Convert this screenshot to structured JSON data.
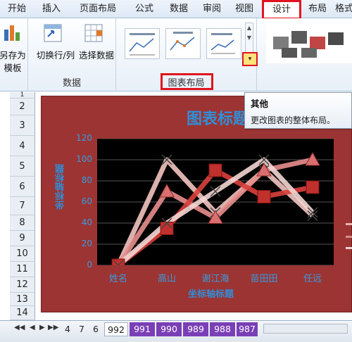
{
  "ribbon_tabs": [
    "开始",
    "插入",
    "页面布局",
    "公式",
    "数据",
    "审阅",
    "视图",
    "设计",
    "布局",
    "格式"
  ],
  "ribbon": {
    "save_template_line1": "另存为",
    "save_template_line2": "模板",
    "switch_rowcol": "切换行/列",
    "select_data": "选择数据",
    "group_data": "数据",
    "group_chart_layout": "图表布局"
  },
  "tooltip": {
    "title": "其他",
    "desc": "更改图表的整体布局。"
  },
  "rows": [
    "1",
    "2",
    "3",
    "4",
    "5",
    "6",
    "7",
    "8",
    "9",
    "10",
    "11",
    "12",
    "13",
    "14"
  ],
  "chart_data": {
    "type": "line",
    "title": "图表标题",
    "xlabel": "坐标轴标题",
    "ylabel": "坐标轴标题",
    "categories": [
      "姓名",
      "高山",
      "谢江海",
      "苗田田",
      "任远"
    ],
    "yticks": [
      "0",
      "20",
      "40",
      "60",
      "80",
      "100",
      "120"
    ],
    "ylim": [
      0,
      120
    ],
    "series": [
      {
        "values": [
          0,
          100,
          50,
          90,
          47
        ],
        "marker": "cross",
        "color": "#f2c4c0"
      },
      {
        "values": [
          0,
          70,
          45,
          90,
          100
        ],
        "marker": "triangle",
        "color": "#e88d8d"
      },
      {
        "values": [
          0,
          35,
          90,
          65,
          74
        ],
        "marker": "square",
        "color": "#d8403c"
      },
      {
        "values": [
          0,
          40,
          70,
          100,
          50
        ],
        "marker": "cross",
        "color": "#f4d7d4"
      }
    ]
  },
  "sheet_tabs": [
    "4",
    "7",
    "6",
    "992",
    "991",
    "990",
    "989",
    "988",
    "987"
  ],
  "colors": {
    "accent_red": "#e0141e",
    "chart_bg": "#9b3432",
    "title_blue": "#2f8fd8",
    "purple_tab": "#7a3fb5"
  }
}
